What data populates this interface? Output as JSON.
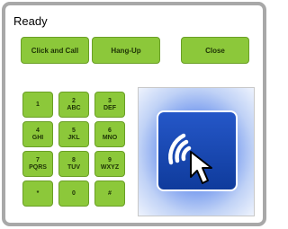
{
  "status": {
    "text": "Ready"
  },
  "buttons": {
    "call": "Click and Call",
    "hangup": "Hang-Up",
    "close": "Close"
  },
  "keypad": [
    {
      "digit": "1",
      "letters": ""
    },
    {
      "digit": "2",
      "letters": "ABC"
    },
    {
      "digit": "3",
      "letters": "DEF"
    },
    {
      "digit": "4",
      "letters": "GHI"
    },
    {
      "digit": "5",
      "letters": "JKL"
    },
    {
      "digit": "6",
      "letters": "MNO"
    },
    {
      "digit": "7",
      "letters": "PQRS"
    },
    {
      "digit": "8",
      "letters": "TUV"
    },
    {
      "digit": "9",
      "letters": "WXYZ"
    },
    {
      "digit": "*",
      "letters": ""
    },
    {
      "digit": "0",
      "letters": ""
    },
    {
      "digit": "#",
      "letters": ""
    }
  ],
  "icon": {
    "name": "wireless-click-icon"
  },
  "colors": {
    "button": "#8cc83a",
    "button_border": "#6a9f25",
    "frame_border": "#a8a8a8",
    "icon_tile": "#1a4ab4"
  }
}
